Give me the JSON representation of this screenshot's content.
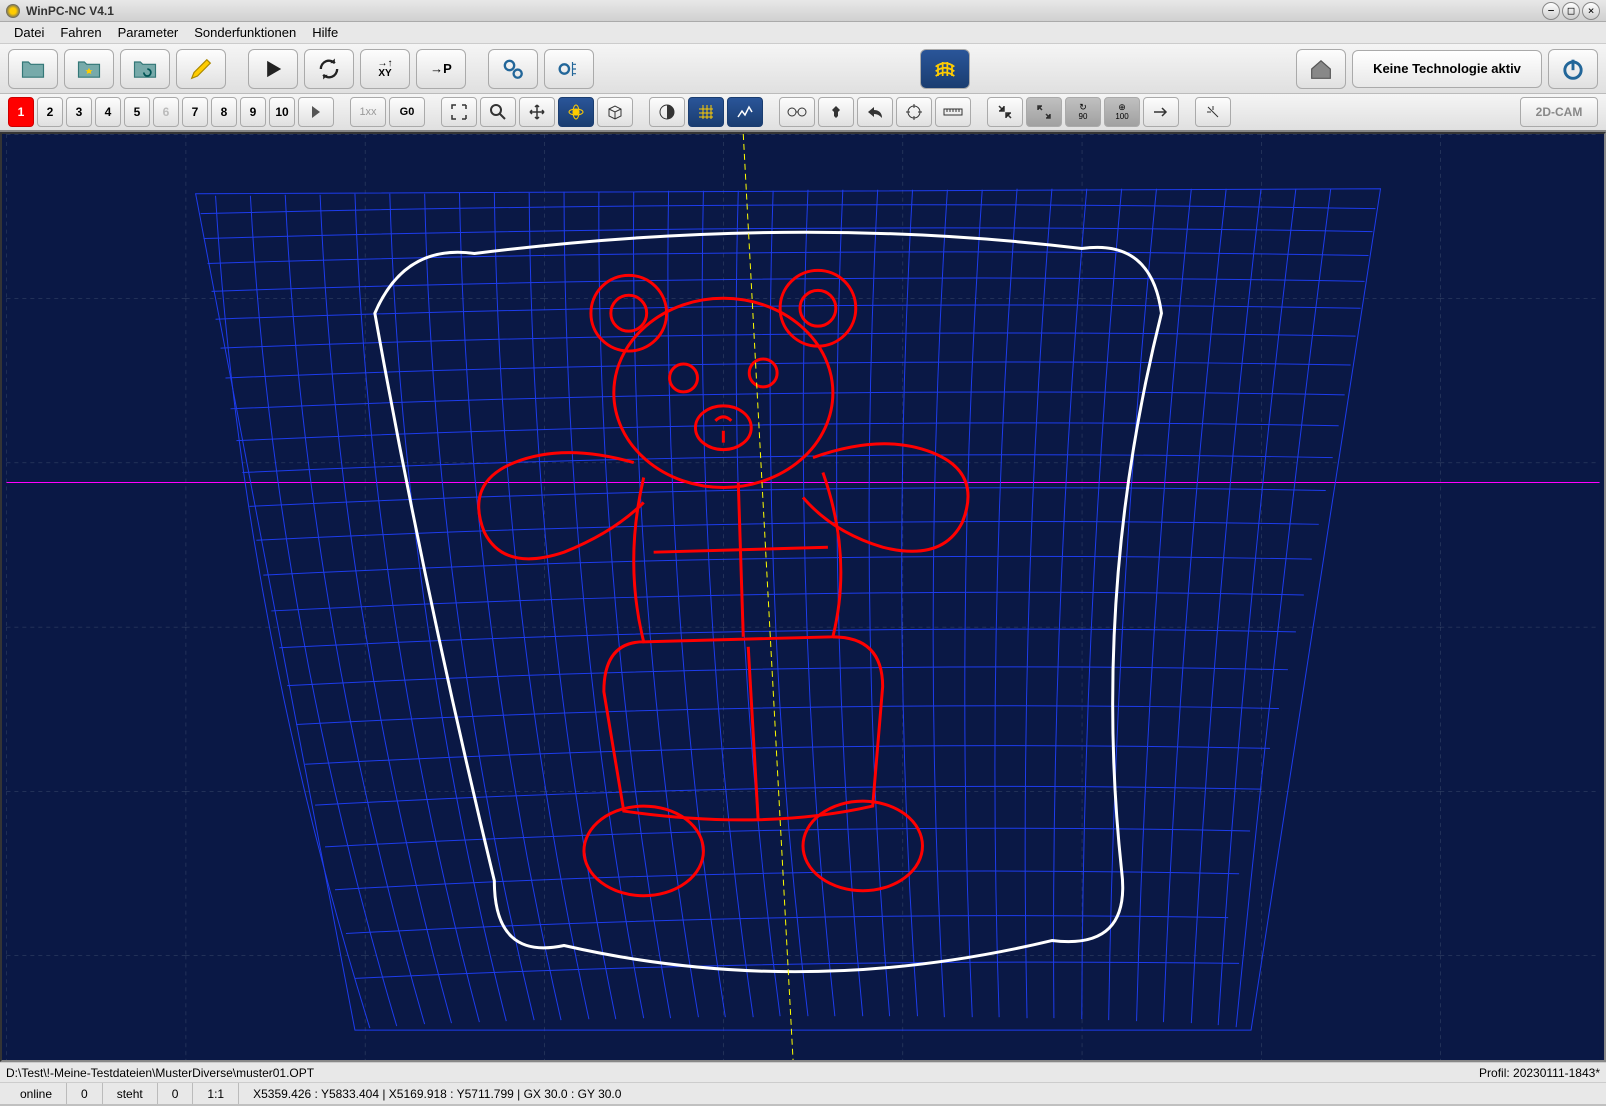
{
  "title": "WinPC-NC V4.1",
  "menu": [
    "Datei",
    "Fahren",
    "Parameter",
    "Sonderfunktionen",
    "Hilfe"
  ],
  "tech_status": "Keine Technologie aktiv",
  "layer_nums": [
    "1",
    "2",
    "3",
    "4",
    "5",
    "6",
    "7",
    "8",
    "9",
    "10"
  ],
  "tb2_1xx": "1xx",
  "tb2_g0": "G0",
  "xy_label": "XY",
  "p_label": "P",
  "deg90": "90",
  "deg100": "100",
  "cam_label": "2D-CAM",
  "file_path": "D:\\Test\\!-Meine-Testdateien\\MusterDiverse\\muster01.OPT",
  "profile": "Profil: 20230111-1843*",
  "status": {
    "online": "online",
    "v1": "0",
    "steht": "steht",
    "v2": "0",
    "ratio": "1:1",
    "coords": "X5359.426 : Y5833.404  |  X5169.918 : Y5711.799  |  GX  30.0 : GY  30.0"
  }
}
